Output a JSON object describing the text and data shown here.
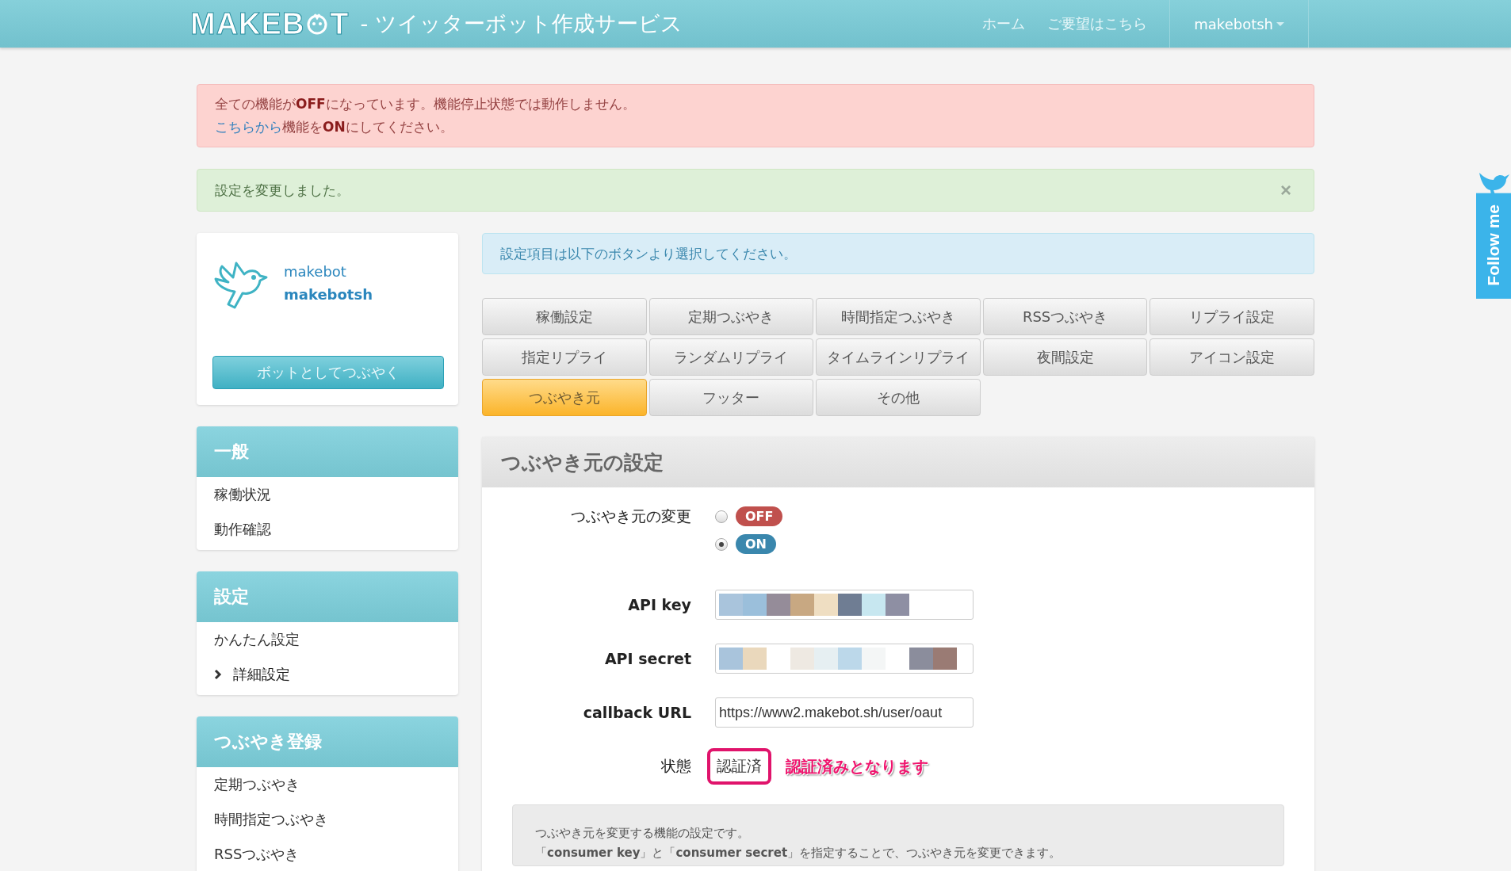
{
  "header": {
    "logo_left": "MAKEB",
    "logo_right": "T",
    "subtitle": "- ツイッターボット作成サービス",
    "nav": [
      "ホーム",
      "ご要望はこちら"
    ],
    "user_menu": "makebotsh"
  },
  "alerts": {
    "error_line1": "全ての機能が**OFF**になっています。機能停止状態では動作しません。",
    "error_link": "こちらから",
    "error_line2": "機能を**ON**にしてください。",
    "success": "設定を変更しました。",
    "success_close": "×"
  },
  "profile": {
    "name": "makebot",
    "screen_name": "makebotsh",
    "tweet_button": "ボットとしてつぶやく"
  },
  "sidebar": [
    {
      "title": "一般",
      "items": [
        {
          "label": "稼働状況",
          "selected": false
        },
        {
          "label": "動作確認",
          "selected": false
        }
      ]
    },
    {
      "title": "設定",
      "items": [
        {
          "label": "かんたん設定",
          "selected": false
        },
        {
          "label": "詳細設定",
          "selected": true
        }
      ]
    },
    {
      "title": "つぶやき登録",
      "items": [
        {
          "label": "定期つぶやき",
          "selected": false
        },
        {
          "label": "時間指定つぶやき",
          "selected": false
        },
        {
          "label": "RSSつぶやき",
          "selected": false
        }
      ]
    }
  ],
  "info": "設定項目は以下のボタンより選択してください。",
  "setting_buttons": [
    {
      "label": "稼働設定",
      "selected": false
    },
    {
      "label": "定期つぶやき",
      "selected": false
    },
    {
      "label": "時間指定つぶやき",
      "selected": false
    },
    {
      "label": "RSSつぶやき",
      "selected": false
    },
    {
      "label": "リプライ設定",
      "selected": false
    },
    {
      "label": "指定リプライ",
      "selected": false
    },
    {
      "label": "ランダムリプライ",
      "selected": false
    },
    {
      "label": "タイムラインリプライ",
      "selected": false
    },
    {
      "label": "夜間設定",
      "selected": false
    },
    {
      "label": "アイコン設定",
      "selected": false
    },
    {
      "label": "つぶやき元",
      "selected": true
    },
    {
      "label": "フッター",
      "selected": false
    },
    {
      "label": "その他",
      "selected": false
    }
  ],
  "panel": {
    "title": "つぶやき元の設定",
    "toggle_label": "つぶやき元の変更",
    "toggle_options": [
      {
        "label": "OFF",
        "selected": false,
        "color": "#c0504d"
      },
      {
        "label": "ON",
        "selected": true,
        "color": "#3a87ad"
      }
    ],
    "fields": [
      {
        "label": "API key",
        "kind": "masked"
      },
      {
        "label": "API secret",
        "kind": "masked"
      },
      {
        "label": "callback URL",
        "kind": "text",
        "value": "https://www2.makebot.sh/user/oaut"
      }
    ],
    "status_label": "状態",
    "status_value": "認証済",
    "status_note": "認証済みとなります",
    "notes": [
      "つぶやき元を変更する機能の設定です。",
      "「**consumer key**」と「**consumer secret**」を指定することで、つぶやき元を変更できます。"
    ]
  },
  "follow_me": "Follow me"
}
